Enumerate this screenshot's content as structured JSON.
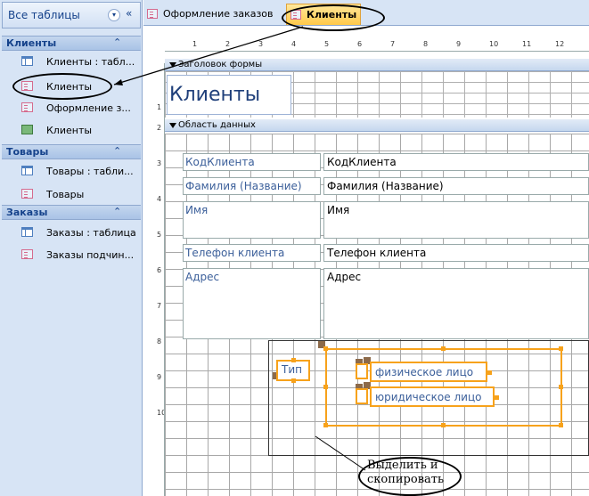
{
  "nav": {
    "title": "Все таблицы",
    "dropdown_glyph": "▾",
    "collapse_glyph": "«",
    "groups": [
      {
        "title": "Клиенты",
        "chevron": "⌃",
        "items": [
          {
            "label": "Клиенты : табл...",
            "icon": "table-icon"
          },
          {
            "label": "Клиенты",
            "icon": "form-icon"
          },
          {
            "label": "Оформление з...",
            "icon": "form-icon"
          },
          {
            "label": "Клиенты",
            "icon": "report-icon"
          }
        ]
      },
      {
        "title": "Товары",
        "chevron": "⌃",
        "items": [
          {
            "label": "Товары : табли...",
            "icon": "table-icon"
          },
          {
            "label": "Товары",
            "icon": "form-icon"
          }
        ]
      },
      {
        "title": "Заказы",
        "chevron": "⌃",
        "items": [
          {
            "label": "Заказы : таблица",
            "icon": "table-icon"
          },
          {
            "label": "Заказы подчин...",
            "icon": "form-icon"
          }
        ]
      }
    ]
  },
  "tabs": [
    {
      "label": "Оформление заказов",
      "active": false
    },
    {
      "label": "Клиенты",
      "active": true
    }
  ],
  "ruler": {
    "top_marks": [
      "1",
      "2",
      "3",
      "4",
      "5",
      "6",
      "7",
      "8",
      "9",
      "10",
      "11",
      "12"
    ],
    "left_marks": [
      "1",
      "2",
      "3",
      "4",
      "5",
      "6",
      "7",
      "8",
      "9",
      "10"
    ]
  },
  "sections": {
    "header": "Заголовок формы",
    "detail": "Область данных"
  },
  "form_title": "Клиенты",
  "fields": [
    {
      "label": "КодКлиента",
      "value": "КодКлиента"
    },
    {
      "label": "Фамилия (Название)",
      "value": "Фамилия (Название)"
    },
    {
      "label": "Имя",
      "value": "Имя"
    },
    {
      "label": "Телефон клиента",
      "value": "Телефон клиента"
    },
    {
      "label": "Адрес",
      "value": "Адрес"
    }
  ],
  "option_group": {
    "label": "Тип",
    "options": [
      "физическое лицо",
      "юридическое лицо"
    ]
  },
  "callout": "Выделить и скопировать",
  "colors": {
    "selection": "#f7a21b",
    "nav_bg": "#d7e4f5",
    "label_text": "#3b5f9a",
    "active_tab": "#ffc94a"
  }
}
